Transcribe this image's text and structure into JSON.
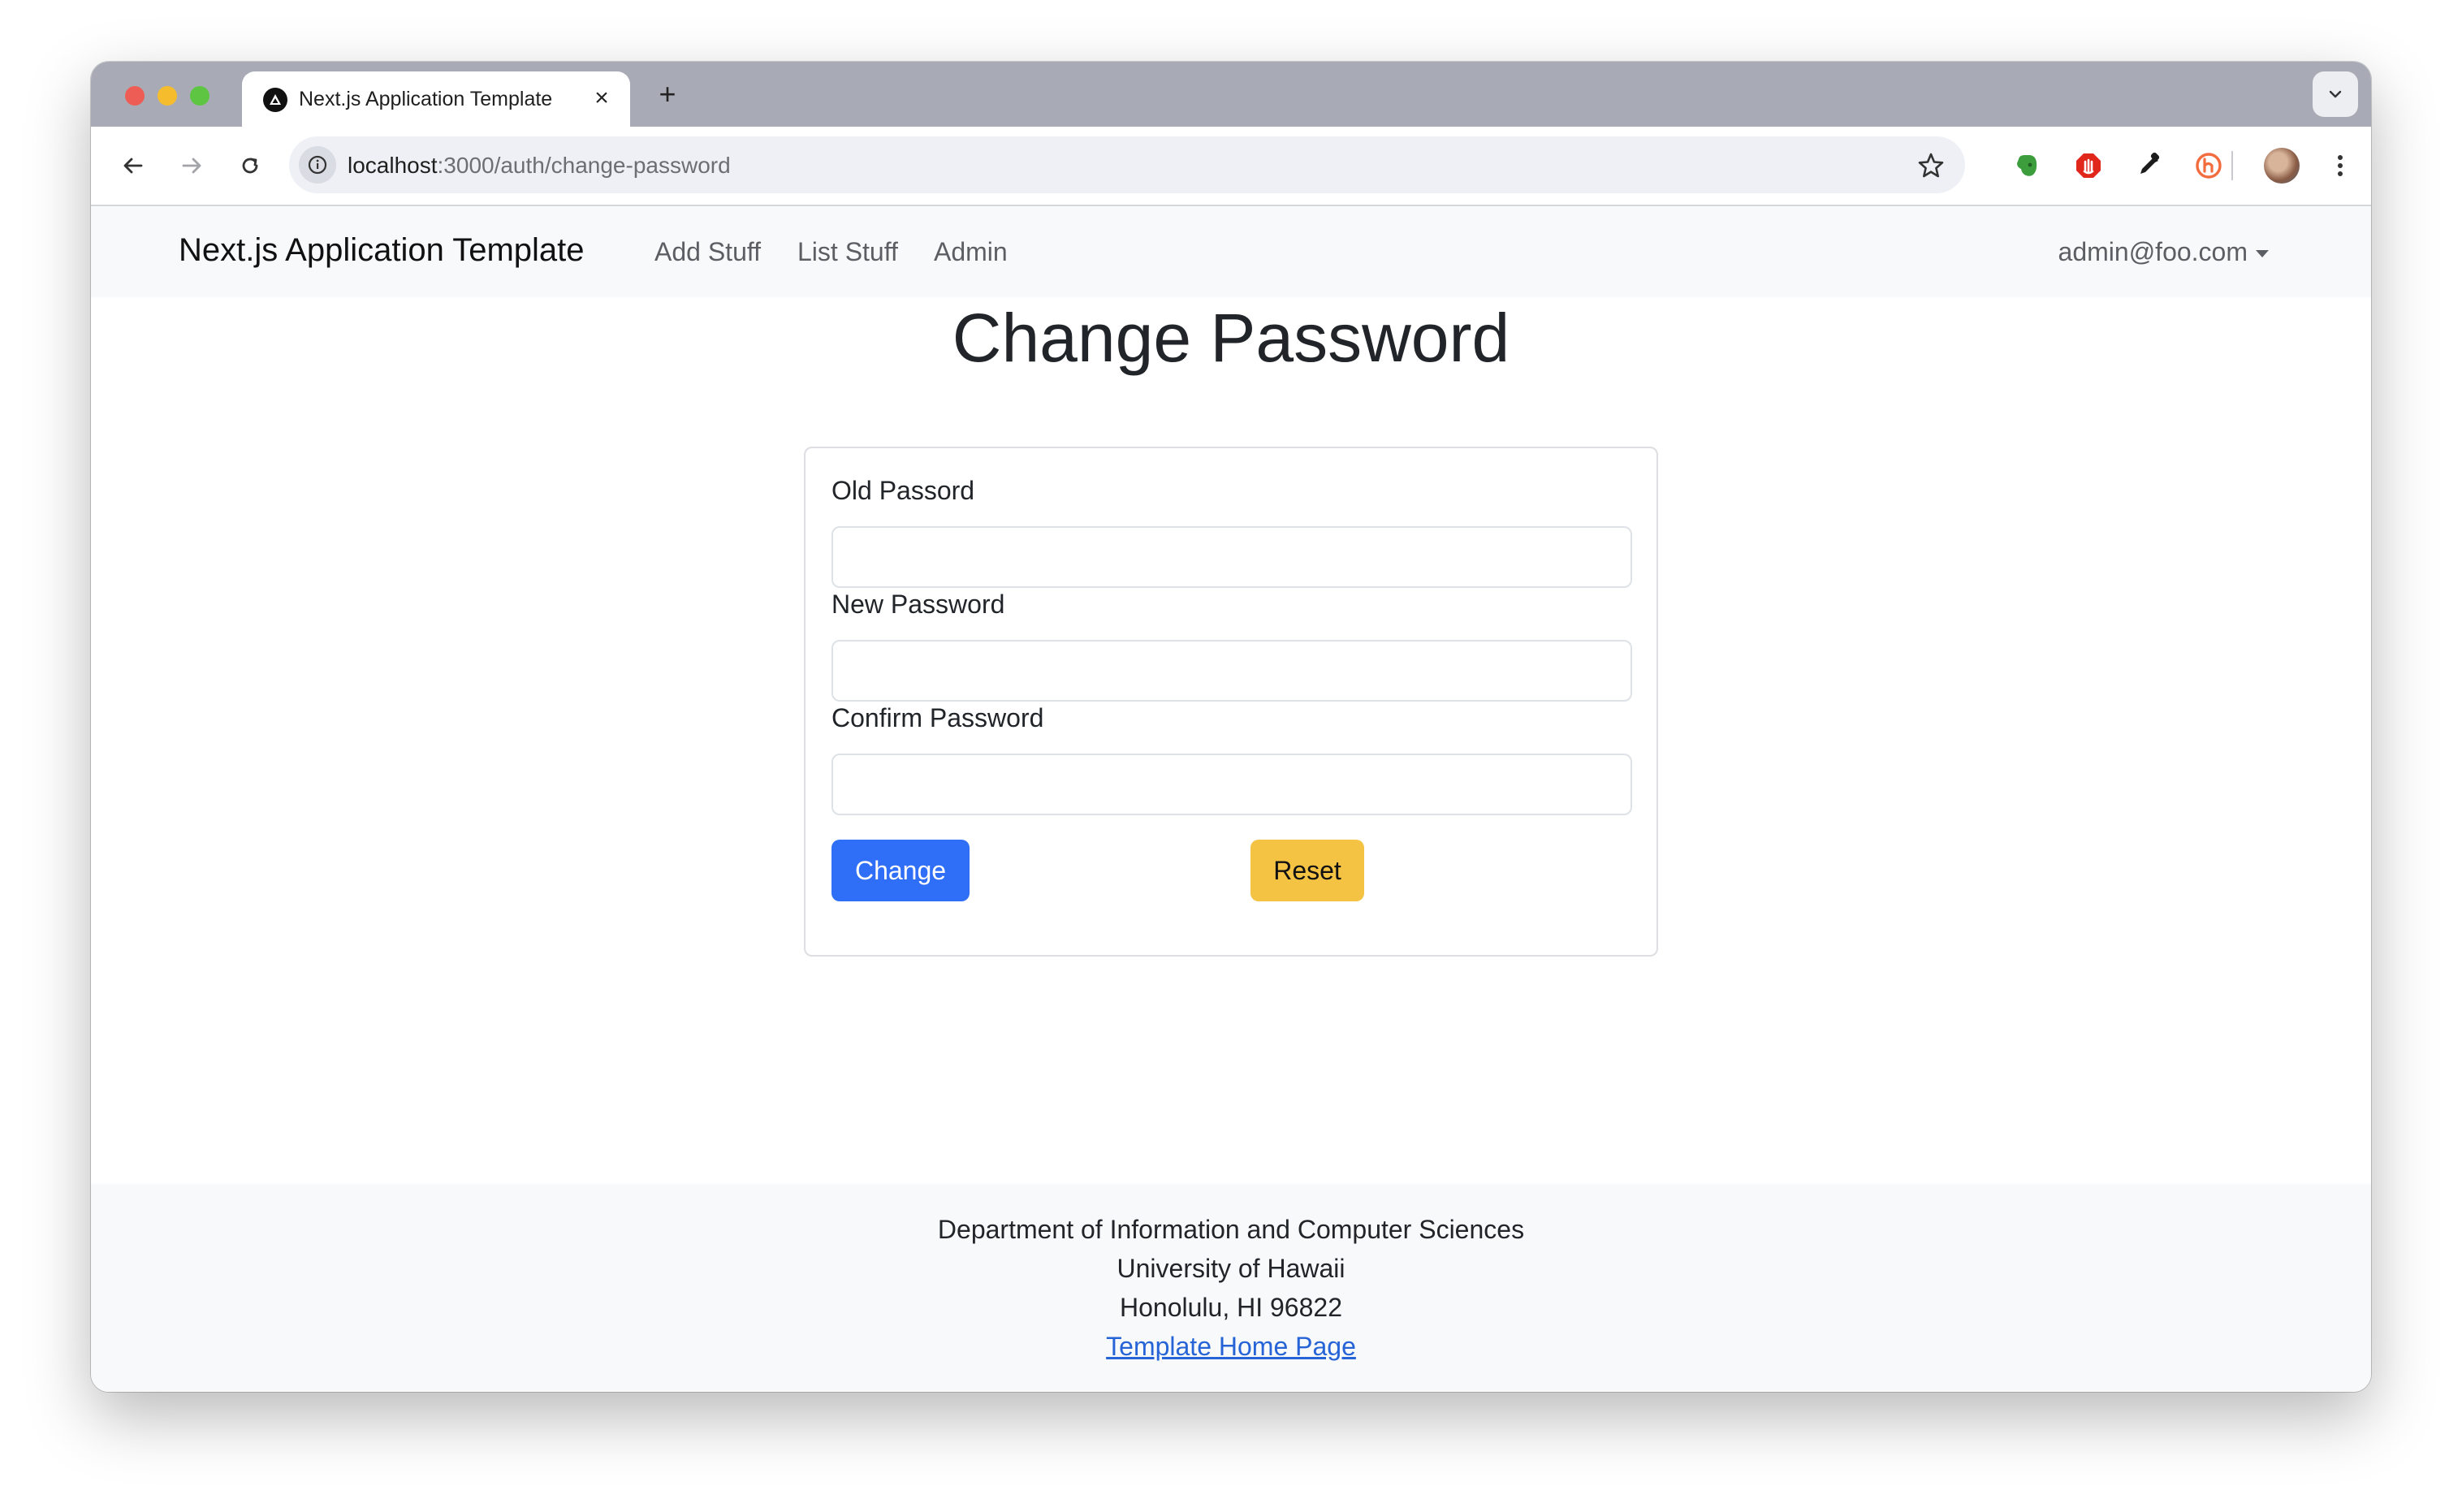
{
  "browser": {
    "tab_title": "Next.js Application Template",
    "url_host": "localhost",
    "url_path": ":3000/auth/change-password"
  },
  "navbar": {
    "brand": "Next.js Application Template",
    "links": [
      "Add Stuff",
      "List Stuff",
      "Admin"
    ],
    "user": "admin@foo.com"
  },
  "main": {
    "title": "Change Password",
    "form": {
      "old_password_label": "Old Passord",
      "old_password_value": "",
      "new_password_label": "New Password",
      "new_password_value": "",
      "confirm_password_label": "Confirm Password",
      "confirm_password_value": "",
      "change_button": "Change",
      "reset_button": "Reset"
    }
  },
  "footer": {
    "lines": [
      "Department of Information and Computer Sciences",
      "University of Hawaii",
      "Honolulu, HI 96822"
    ],
    "link": "Template Home Page"
  },
  "colors": {
    "primary": "#2f6ef6",
    "warning": "#f4c344",
    "link": "#2563d6",
    "navbar_bg": "#f8f9fa"
  },
  "icons": {
    "tab": "nextjs-favicon",
    "extensions": [
      "evernote-icon",
      "adblock-icon",
      "eyedropper-icon",
      "honey-icon",
      "puzzle-icon"
    ]
  }
}
